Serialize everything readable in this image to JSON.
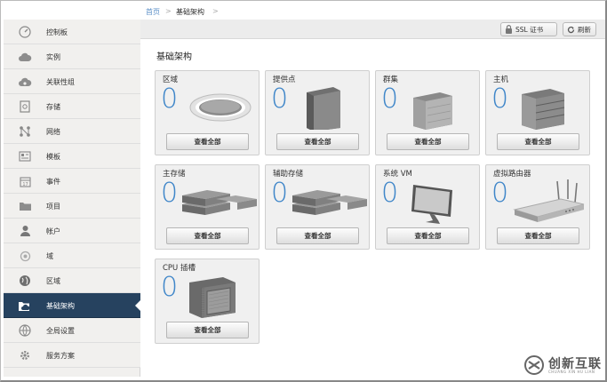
{
  "breadcrumb": {
    "home": "首页",
    "sep": ">",
    "current": "基础架构"
  },
  "toolbar": {
    "ssl_label": "SSL 证书",
    "refresh_label": "刷新"
  },
  "sidebar": {
    "items": [
      {
        "label": "控制板",
        "icon": "dashboard-icon"
      },
      {
        "label": "实例",
        "icon": "cloud-icon"
      },
      {
        "label": "关联性组",
        "icon": "cloud-group-icon"
      },
      {
        "label": "存储",
        "icon": "storage-icon"
      },
      {
        "label": "网络",
        "icon": "network-icon"
      },
      {
        "label": "模板",
        "icon": "template-icon"
      },
      {
        "label": "事件",
        "icon": "calendar-icon"
      },
      {
        "label": "项目",
        "icon": "folder-icon"
      },
      {
        "label": "帐户",
        "icon": "user-icon"
      },
      {
        "label": "域",
        "icon": "domain-icon"
      },
      {
        "label": "区域",
        "icon": "globe-icon"
      },
      {
        "label": "基础架构",
        "icon": "folder-cloud-icon",
        "active": true
      },
      {
        "label": "全局设置",
        "icon": "world-settings-icon"
      },
      {
        "label": "服务方案",
        "icon": "gear-icon"
      }
    ]
  },
  "main": {
    "title": "基础架构",
    "view_all_label": "查看全部",
    "cards": [
      {
        "title": "区域",
        "count": "0",
        "icon": "zone-icon"
      },
      {
        "title": "提供点",
        "count": "0",
        "icon": "pod-icon"
      },
      {
        "title": "群集",
        "count": "0",
        "icon": "cluster-icon"
      },
      {
        "title": "主机",
        "count": "0",
        "icon": "host-icon"
      },
      {
        "title": "主存储",
        "count": "0",
        "icon": "primary-storage-icon"
      },
      {
        "title": "辅助存储",
        "count": "0",
        "icon": "secondary-storage-icon"
      },
      {
        "title": "系统 VM",
        "count": "0",
        "icon": "system-vm-icon"
      },
      {
        "title": "虚拟路由器",
        "count": "0",
        "icon": "router-icon"
      },
      {
        "title": "CPU 插槽",
        "count": "0",
        "icon": "cpu-socket-icon"
      }
    ]
  },
  "watermark": {
    "text": "创新互联",
    "sub": "CHUANG XIN HU LIAN"
  },
  "colors": {
    "accent": "#3f86c9",
    "sidebar_active": "#26425f",
    "link": "#5b8fc7"
  }
}
